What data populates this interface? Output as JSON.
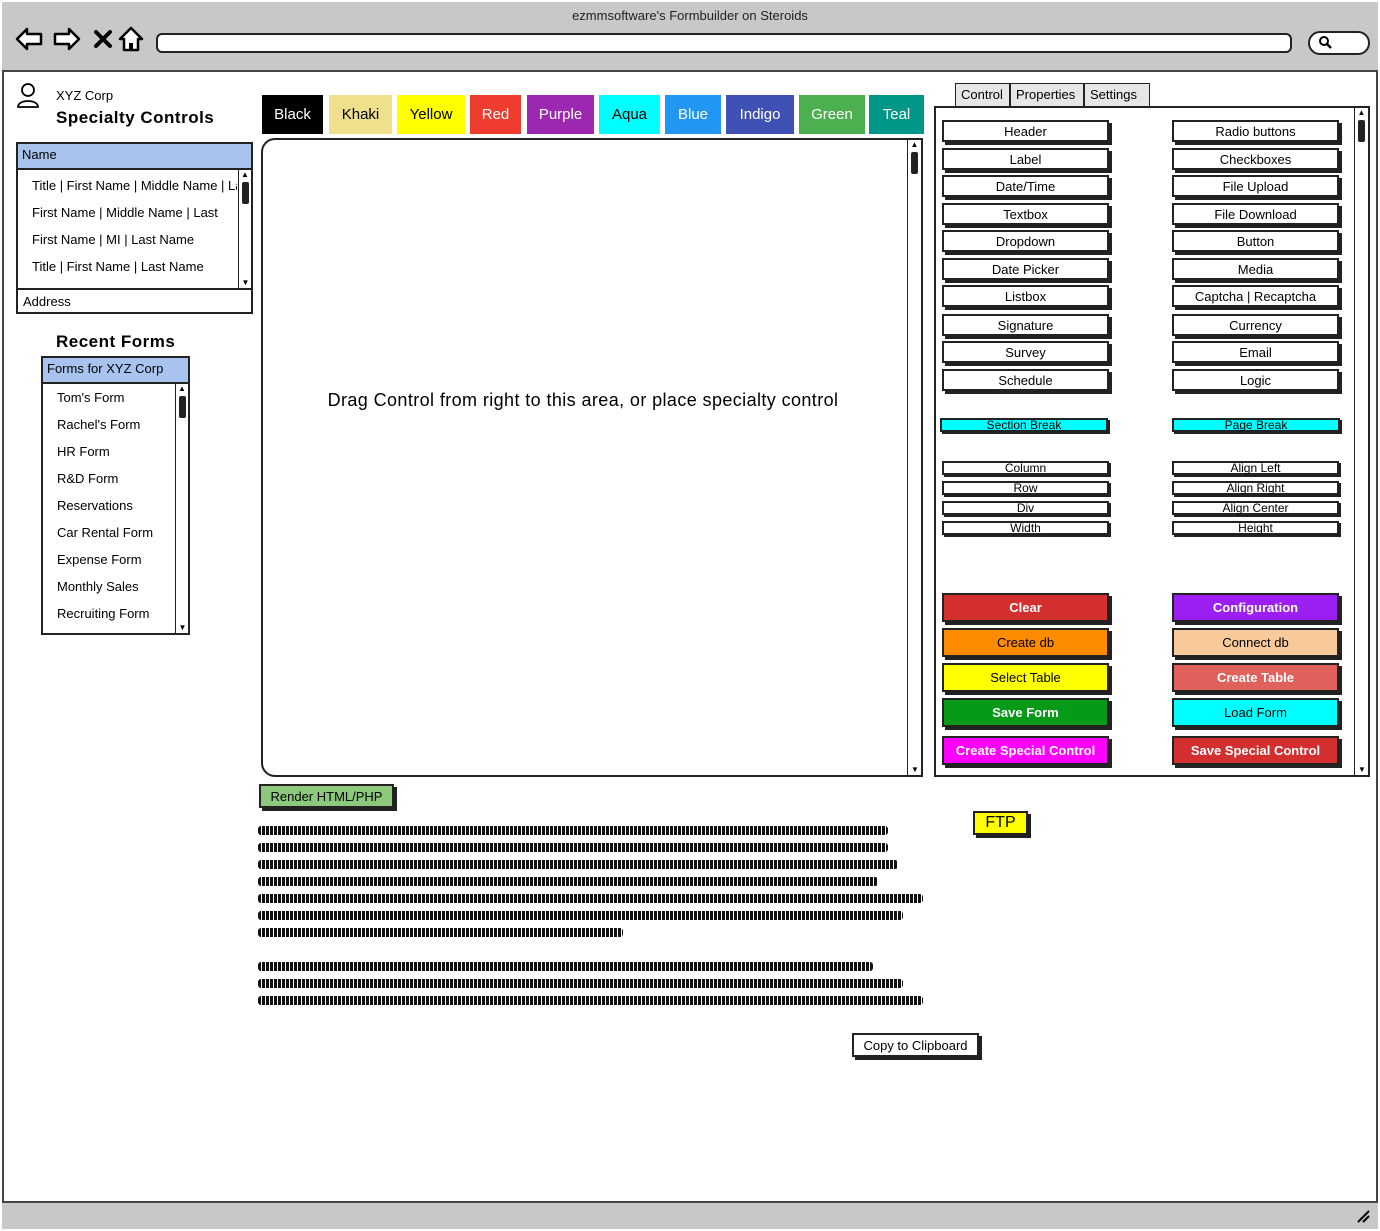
{
  "window": {
    "title": "ezmmsoftware's Formbuilder on Steroids"
  },
  "left": {
    "company": "XYZ Corp",
    "specialty_title": "Specialty Controls",
    "specialty_list": {
      "header": "Name",
      "items": [
        "Title | First Name | Middle Name | Last",
        "First Name | Middle Name | Last",
        "First Name | MI | Last Name",
        "Title | First Name | Last Name"
      ],
      "footer": "Address"
    },
    "recent_title": "Recent Forms",
    "recent_list": {
      "header": "Forms for XYZ Corp",
      "items": [
        "Tom's Form",
        "Rachel's Form",
        "HR Form",
        "R&D Form",
        "Reservations",
        "Car Rental Form",
        "Expense Form",
        "Monthly Sales",
        "Recruiting Form"
      ]
    }
  },
  "color_tabs": [
    {
      "label": "Black",
      "bg": "#000000",
      "fg": "#ffffff"
    },
    {
      "label": "Khaki",
      "bg": "#eee08c",
      "fg": "#000000"
    },
    {
      "label": "Yellow",
      "bg": "#ffff00",
      "fg": "#000000"
    },
    {
      "label": "Red",
      "bg": "#f03c2e",
      "fg": "#ffffff"
    },
    {
      "label": "Purple",
      "bg": "#9c27b0",
      "fg": "#ffffff"
    },
    {
      "label": "Aqua",
      "bg": "#00ffff",
      "fg": "#000000"
    },
    {
      "label": "Blue",
      "bg": "#2196f3",
      "fg": "#ffffff"
    },
    {
      "label": "Indigo",
      "bg": "#3f51b5",
      "fg": "#ffffff"
    },
    {
      "label": "Green",
      "bg": "#4caf50",
      "fg": "#ffffff"
    },
    {
      "label": "Teal",
      "bg": "#009688",
      "fg": "#ffffff"
    }
  ],
  "canvas": {
    "message": "Drag Control from right to this area, or place specialty control"
  },
  "render_button": "Render HTML/PHP",
  "ftp_button": "FTP",
  "copy_button": "Copy to Clipboard",
  "right": {
    "tabs": [
      "Control",
      "Properties",
      "Settings"
    ],
    "controls_left": [
      "Header",
      "Label",
      "Date/Time",
      "Textbox",
      "Dropdown",
      "Date Picker",
      "Listbox",
      "Signature",
      "Survey",
      "Schedule"
    ],
    "controls_right": [
      "Radio buttons",
      "Checkboxes",
      "File Upload",
      "File Download",
      "Button",
      "Media",
      "Captcha | Recaptcha",
      "Currency",
      "Email",
      "Logic"
    ],
    "breaks": [
      {
        "label": "Section Break",
        "bg": "#00ffff"
      },
      {
        "label": "Page Break",
        "bg": "#00ffff"
      }
    ],
    "layout_left": [
      "Column",
      "Row",
      "Div",
      "Width"
    ],
    "layout_right": [
      "Align Left",
      "Align Right",
      "Align Center",
      "Height"
    ],
    "actions": [
      {
        "label": "Clear",
        "bg": "#d32f2f",
        "fg": "#ffffff",
        "bold": true
      },
      {
        "label": "Configuration",
        "bg": "#9b1ff0",
        "fg": "#ffffff",
        "bold": true
      },
      {
        "label": "Create db",
        "bg": "#ff8c00",
        "fg": "#000000",
        "bold": false
      },
      {
        "label": "Connect db",
        "bg": "#f8c99a",
        "fg": "#000000",
        "bold": false
      },
      {
        "label": "Select Table",
        "bg": "#ffff00",
        "fg": "#000000",
        "bold": false
      },
      {
        "label": "Create Table",
        "bg": "#e0605c",
        "fg": "#ffffff",
        "bold": true
      },
      {
        "label": "Save Form",
        "bg": "#069a18",
        "fg": "#ffffff",
        "bold": true
      },
      {
        "label": "Load Form",
        "bg": "#00ffff",
        "fg": "#000000",
        "bold": false
      },
      {
        "label": "Create Special Control",
        "bg": "#ff00ff",
        "fg": "#ffffff",
        "bold": true
      },
      {
        "label": "Save Special Control",
        "bg": "#d32f2f",
        "fg": "#ffffff",
        "bold": true
      }
    ]
  },
  "icons": {
    "back": "back-arrow-icon",
    "forward": "forward-arrow-icon",
    "stop": "close-icon",
    "home": "home-icon",
    "search": "search-icon",
    "user": "user-icon",
    "resize": "resize-grip-icon"
  }
}
